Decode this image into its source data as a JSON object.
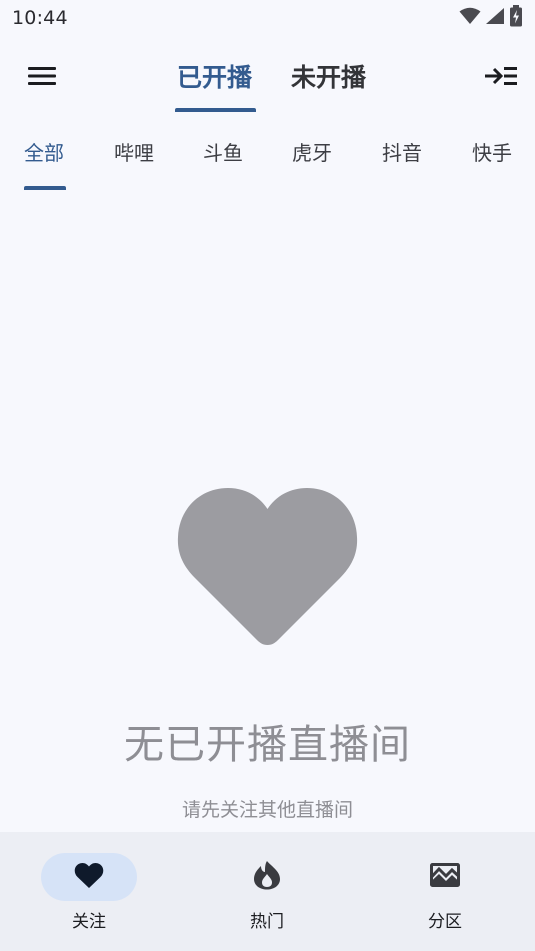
{
  "status_bar": {
    "time": "10:44",
    "icons": [
      "wifi-icon",
      "signal-icon",
      "battery-charging-icon"
    ]
  },
  "top_bar": {
    "menu_icon": "menu-icon",
    "exit_icon": "collapse-menu-icon",
    "tabs": [
      {
        "label": "已开播",
        "active": true
      },
      {
        "label": "未开播",
        "active": false
      }
    ]
  },
  "platform_tabs": [
    {
      "label": "全部",
      "active": true
    },
    {
      "label": "哔哩",
      "active": false
    },
    {
      "label": "斗鱼",
      "active": false
    },
    {
      "label": "虎牙",
      "active": false
    },
    {
      "label": "抖音",
      "active": false
    },
    {
      "label": "快手",
      "active": false
    }
  ],
  "empty_state": {
    "icon": "heart-icon",
    "title": "无已开播直播间",
    "subtitle": "请先关注其他直播间"
  },
  "bottom_nav": [
    {
      "label": "关注",
      "icon": "heart-icon",
      "active": true
    },
    {
      "label": "热门",
      "icon": "fire-icon",
      "active": false
    },
    {
      "label": "分区",
      "icon": "terrain-icon",
      "active": false
    }
  ],
  "colors": {
    "accent": "#335b8f",
    "background": "#f7f8fd",
    "nav_background": "#eceef4",
    "active_pill": "#d6e3f7",
    "muted": "#8e8e94"
  }
}
